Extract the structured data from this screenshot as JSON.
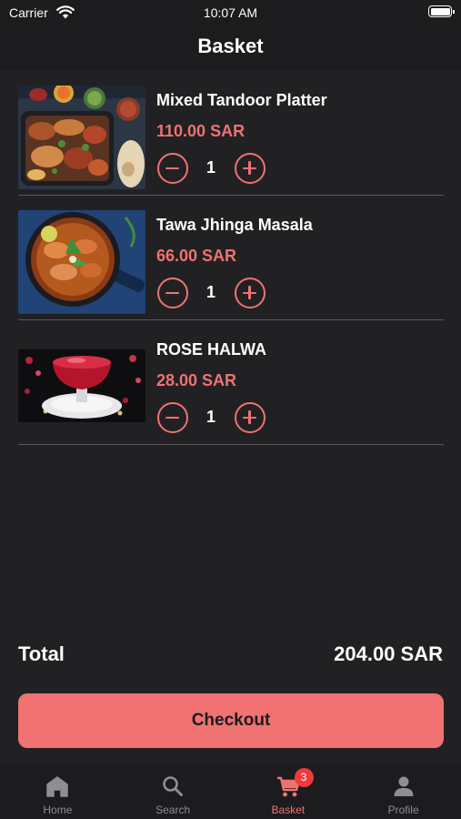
{
  "status_bar": {
    "carrier": "Carrier",
    "time": "10:07 AM"
  },
  "header": {
    "title": "Basket"
  },
  "items": [
    {
      "name": "Mixed Tandoor Platter",
      "price": "110.00 SAR",
      "quantity": "1"
    },
    {
      "name": "Tawa Jhinga Masala",
      "price": "66.00 SAR",
      "quantity": "1"
    },
    {
      "name": "ROSE HALWA",
      "price": "28.00 SAR",
      "quantity": "1"
    }
  ],
  "summary": {
    "total_label": "Total",
    "total_value": "204.00 SAR"
  },
  "checkout": {
    "label": "Checkout"
  },
  "tab_bar": {
    "tabs": [
      {
        "label": "Home",
        "icon": "home-icon",
        "active": false
      },
      {
        "label": "Search",
        "icon": "search-icon",
        "active": false
      },
      {
        "label": "Basket",
        "icon": "cart-icon",
        "active": true,
        "badge": "3"
      },
      {
        "label": "Profile",
        "icon": "person-icon",
        "active": false
      }
    ]
  },
  "colors": {
    "accent": "#f07272",
    "background": "#212123",
    "bar_background": "#1c1c1e",
    "badge": "#ef3b3b",
    "inactive_tab": "#8e8e93"
  }
}
